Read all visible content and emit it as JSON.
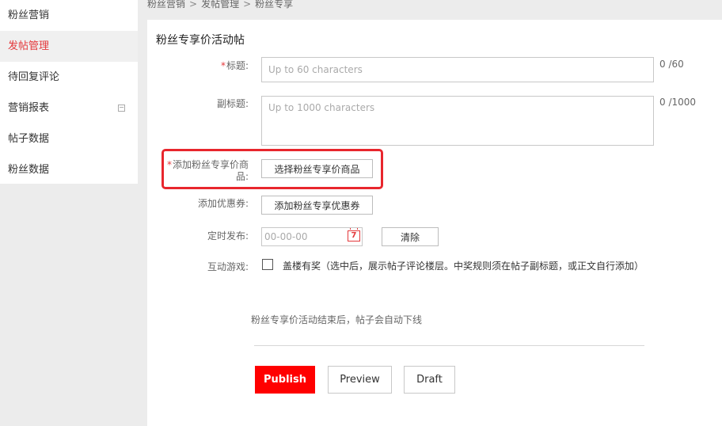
{
  "sidebar": {
    "items": [
      {
        "label": "粉丝营销"
      },
      {
        "label": "发帖管理"
      },
      {
        "label": "待回复评论"
      },
      {
        "label": "营销报表"
      },
      {
        "label": "帖子数据"
      },
      {
        "label": "粉丝数据"
      }
    ],
    "active_index": 1,
    "collapse_symbol": "−"
  },
  "breadcrumb": {
    "items": [
      "粉丝营销",
      "发帖管理",
      "粉丝专享"
    ],
    "separator": ">"
  },
  "form": {
    "title": "粉丝专享价活动帖",
    "required_mark": "*",
    "title_field": {
      "label": "标题:",
      "placeholder": "Up to 60 characters",
      "counter": "0 /60"
    },
    "subtitle_field": {
      "label": "副标题:",
      "placeholder": "Up to 1000 characters",
      "counter": "0 /1000"
    },
    "product_field": {
      "label_line1": "添加粉丝专享价商",
      "label_line2": "品:",
      "button": "选择粉丝专享价商品"
    },
    "coupon_field": {
      "label": "添加优惠券:",
      "button": "添加粉丝专享优惠券"
    },
    "schedule_field": {
      "label": "定时发布:",
      "placeholder": "00-00-00",
      "calendar_glyph": "7",
      "clear_button": "清除"
    },
    "game_field": {
      "label": "互动游戏:",
      "checkbox_text": "盖楼有奖（选中后，展示帖子评论楼层。中奖规则须在帖子副标题，或正文自行添加）",
      "checked": false
    },
    "note": "粉丝专享价活动结束后，帖子会自动下线"
  },
  "actions": {
    "publish": "Publish",
    "preview": "Preview",
    "draft": "Draft"
  },
  "colors": {
    "accent_red": "#ff0000",
    "active_nav_red": "#e4393c",
    "highlight_red": "#e8262d"
  }
}
